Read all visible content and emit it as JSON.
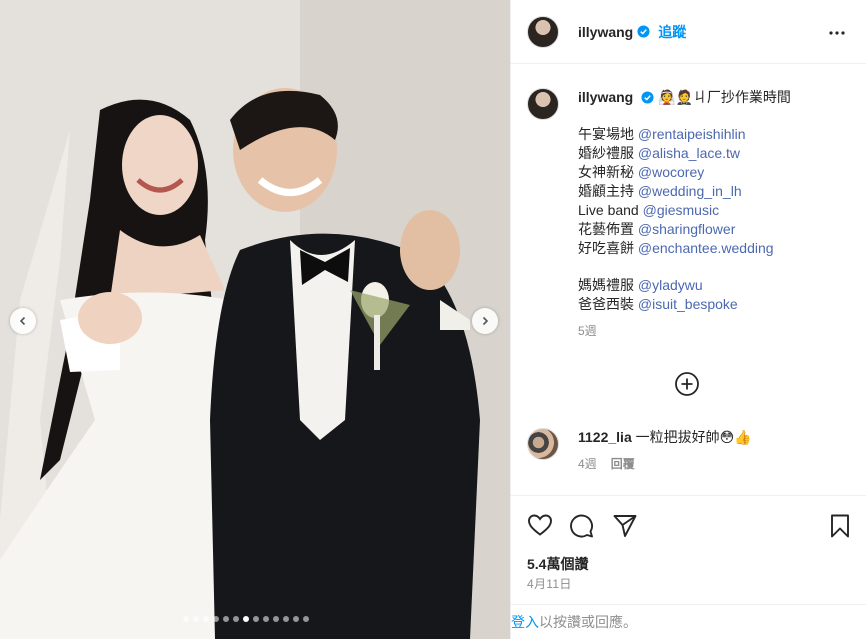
{
  "post": {
    "username": "illywang",
    "follow_label": "追蹤",
    "caption_text": "👰🤵ㄐ厂抄作業時間",
    "credits": [
      {
        "label": "午宴場地",
        "handle": "@rentaipeishihlin"
      },
      {
        "label": "婚紗禮服",
        "handle": "@alisha_lace.tw"
      },
      {
        "label": "女神新秘",
        "handle": "@wocorey"
      },
      {
        "label": "婚顧主持",
        "handle": "@wedding_in_lh"
      },
      {
        "label": "Live band",
        "handle": "@giesmusic"
      },
      {
        "label": "花藝佈置",
        "handle": "@sharingflower"
      },
      {
        "label": "好吃喜餅",
        "handle": "@enchantee.wedding"
      }
    ],
    "family_credits": [
      {
        "label": "媽媽禮服",
        "handle": "@yladywu"
      },
      {
        "label": "爸爸西裝",
        "handle": "@isuit_bespoke"
      }
    ],
    "caption_age": "5週"
  },
  "comment": {
    "username": "1122_lia",
    "text": "一粒把拔好帥😳👍",
    "age": "4週",
    "reply_label": "回覆"
  },
  "stats": {
    "views": "5.4萬個讚",
    "date": "4月11日"
  },
  "footer": {
    "login_label": "登入",
    "rest_text": "以按讚或回應。"
  },
  "carousel": {
    "total": 13,
    "active_index": 6
  },
  "icons": [
    "verified-icon",
    "more-icon",
    "chevron-left-icon",
    "chevron-right-icon",
    "load-more-icon",
    "heart-icon",
    "comment-icon",
    "share-icon",
    "bookmark-icon"
  ],
  "colors": {
    "accent": "#0095f6",
    "mention": "#4b68b0",
    "muted": "#8e8e8e"
  }
}
